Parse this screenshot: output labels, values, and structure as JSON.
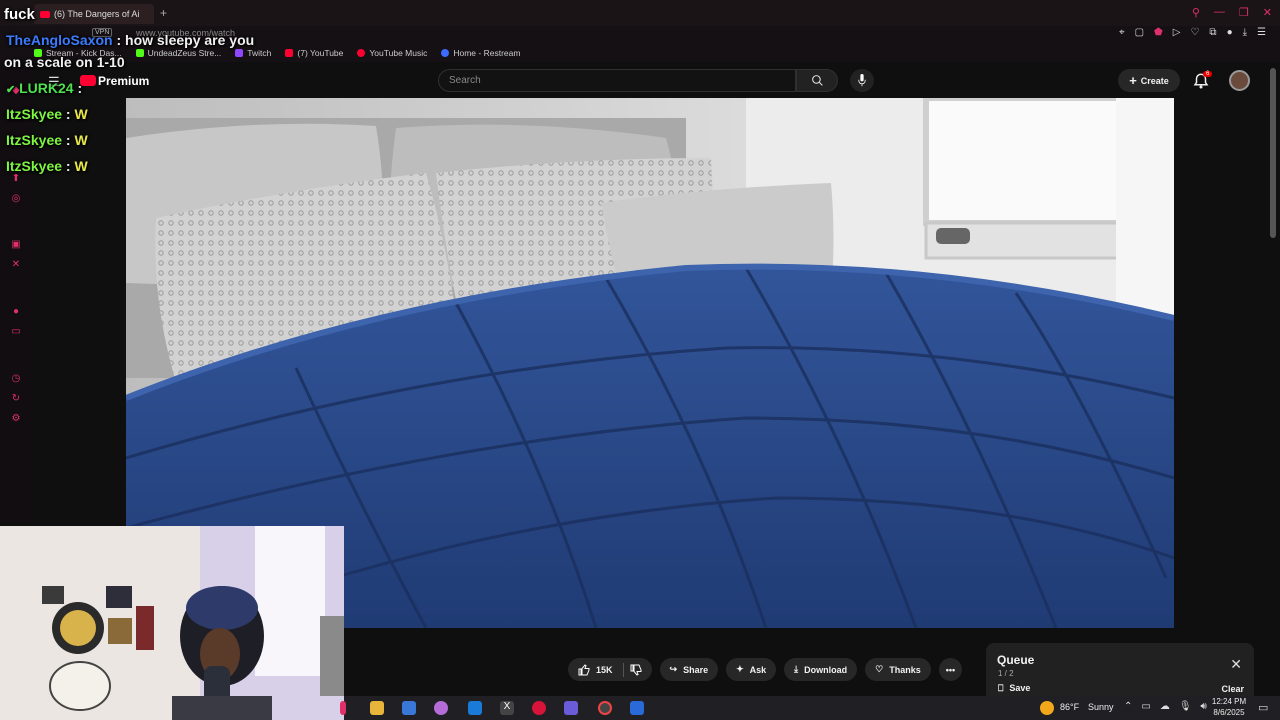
{
  "overlay": {
    "corner_word": "fuck",
    "chat": [
      {
        "user": "TheAngloSaxon",
        "sep": " : ",
        "message": "how sleepy are you",
        "message2": "on a scale on 1-10",
        "color": "#3b7bff"
      },
      {
        "user": "LURK24",
        "sep": " : ",
        "message": "",
        "color": "#4ee04e"
      },
      {
        "user": "ItzSkyee",
        "sep": " : ",
        "message": "W",
        "color": "#7df542"
      },
      {
        "user": "ItzSkyee",
        "sep": " : ",
        "message": "W",
        "color": "#7df542"
      },
      {
        "user": "ItzSkyee",
        "sep": " : ",
        "message": "W",
        "color": "#7df542"
      }
    ]
  },
  "browser": {
    "tab_title": "(6) The Dangers of Ai",
    "url": "www.youtube.com/watch",
    "vpn_label": "VPN",
    "bookmarks": [
      {
        "label": "Stream - Kick Das...",
        "color": "#53fc18"
      },
      {
        "label": "UndeadZeus Stre...",
        "color": "#53fc18"
      },
      {
        "label": "Twitch",
        "color": "#9146ff"
      },
      {
        "label": "(7) YouTube",
        "color": "#ff0033"
      },
      {
        "label": "YouTube Music",
        "color": "#ff0033"
      },
      {
        "label": "Home - Restream",
        "color": "#3d6bff"
      }
    ]
  },
  "youtube": {
    "logo_text": "Premium",
    "search_placeholder": "Search",
    "create_label": "Create",
    "notification_count": "6",
    "actions": {
      "like_count": "15K",
      "share": "Share",
      "ask": "Ask",
      "download": "Download",
      "thanks": "Thanks"
    },
    "queue": {
      "title": "Queue",
      "position": "1 / 2",
      "save": "Save",
      "clear": "Clear"
    }
  },
  "taskbar": {
    "weather_temp": "86°F",
    "weather_cond": "Sunny",
    "time": "12:24 PM",
    "date": "8/6/2025"
  },
  "colors": {
    "accent": "#e0306a",
    "yt_red": "#ff0033",
    "comforter": "#2c4a8c"
  }
}
